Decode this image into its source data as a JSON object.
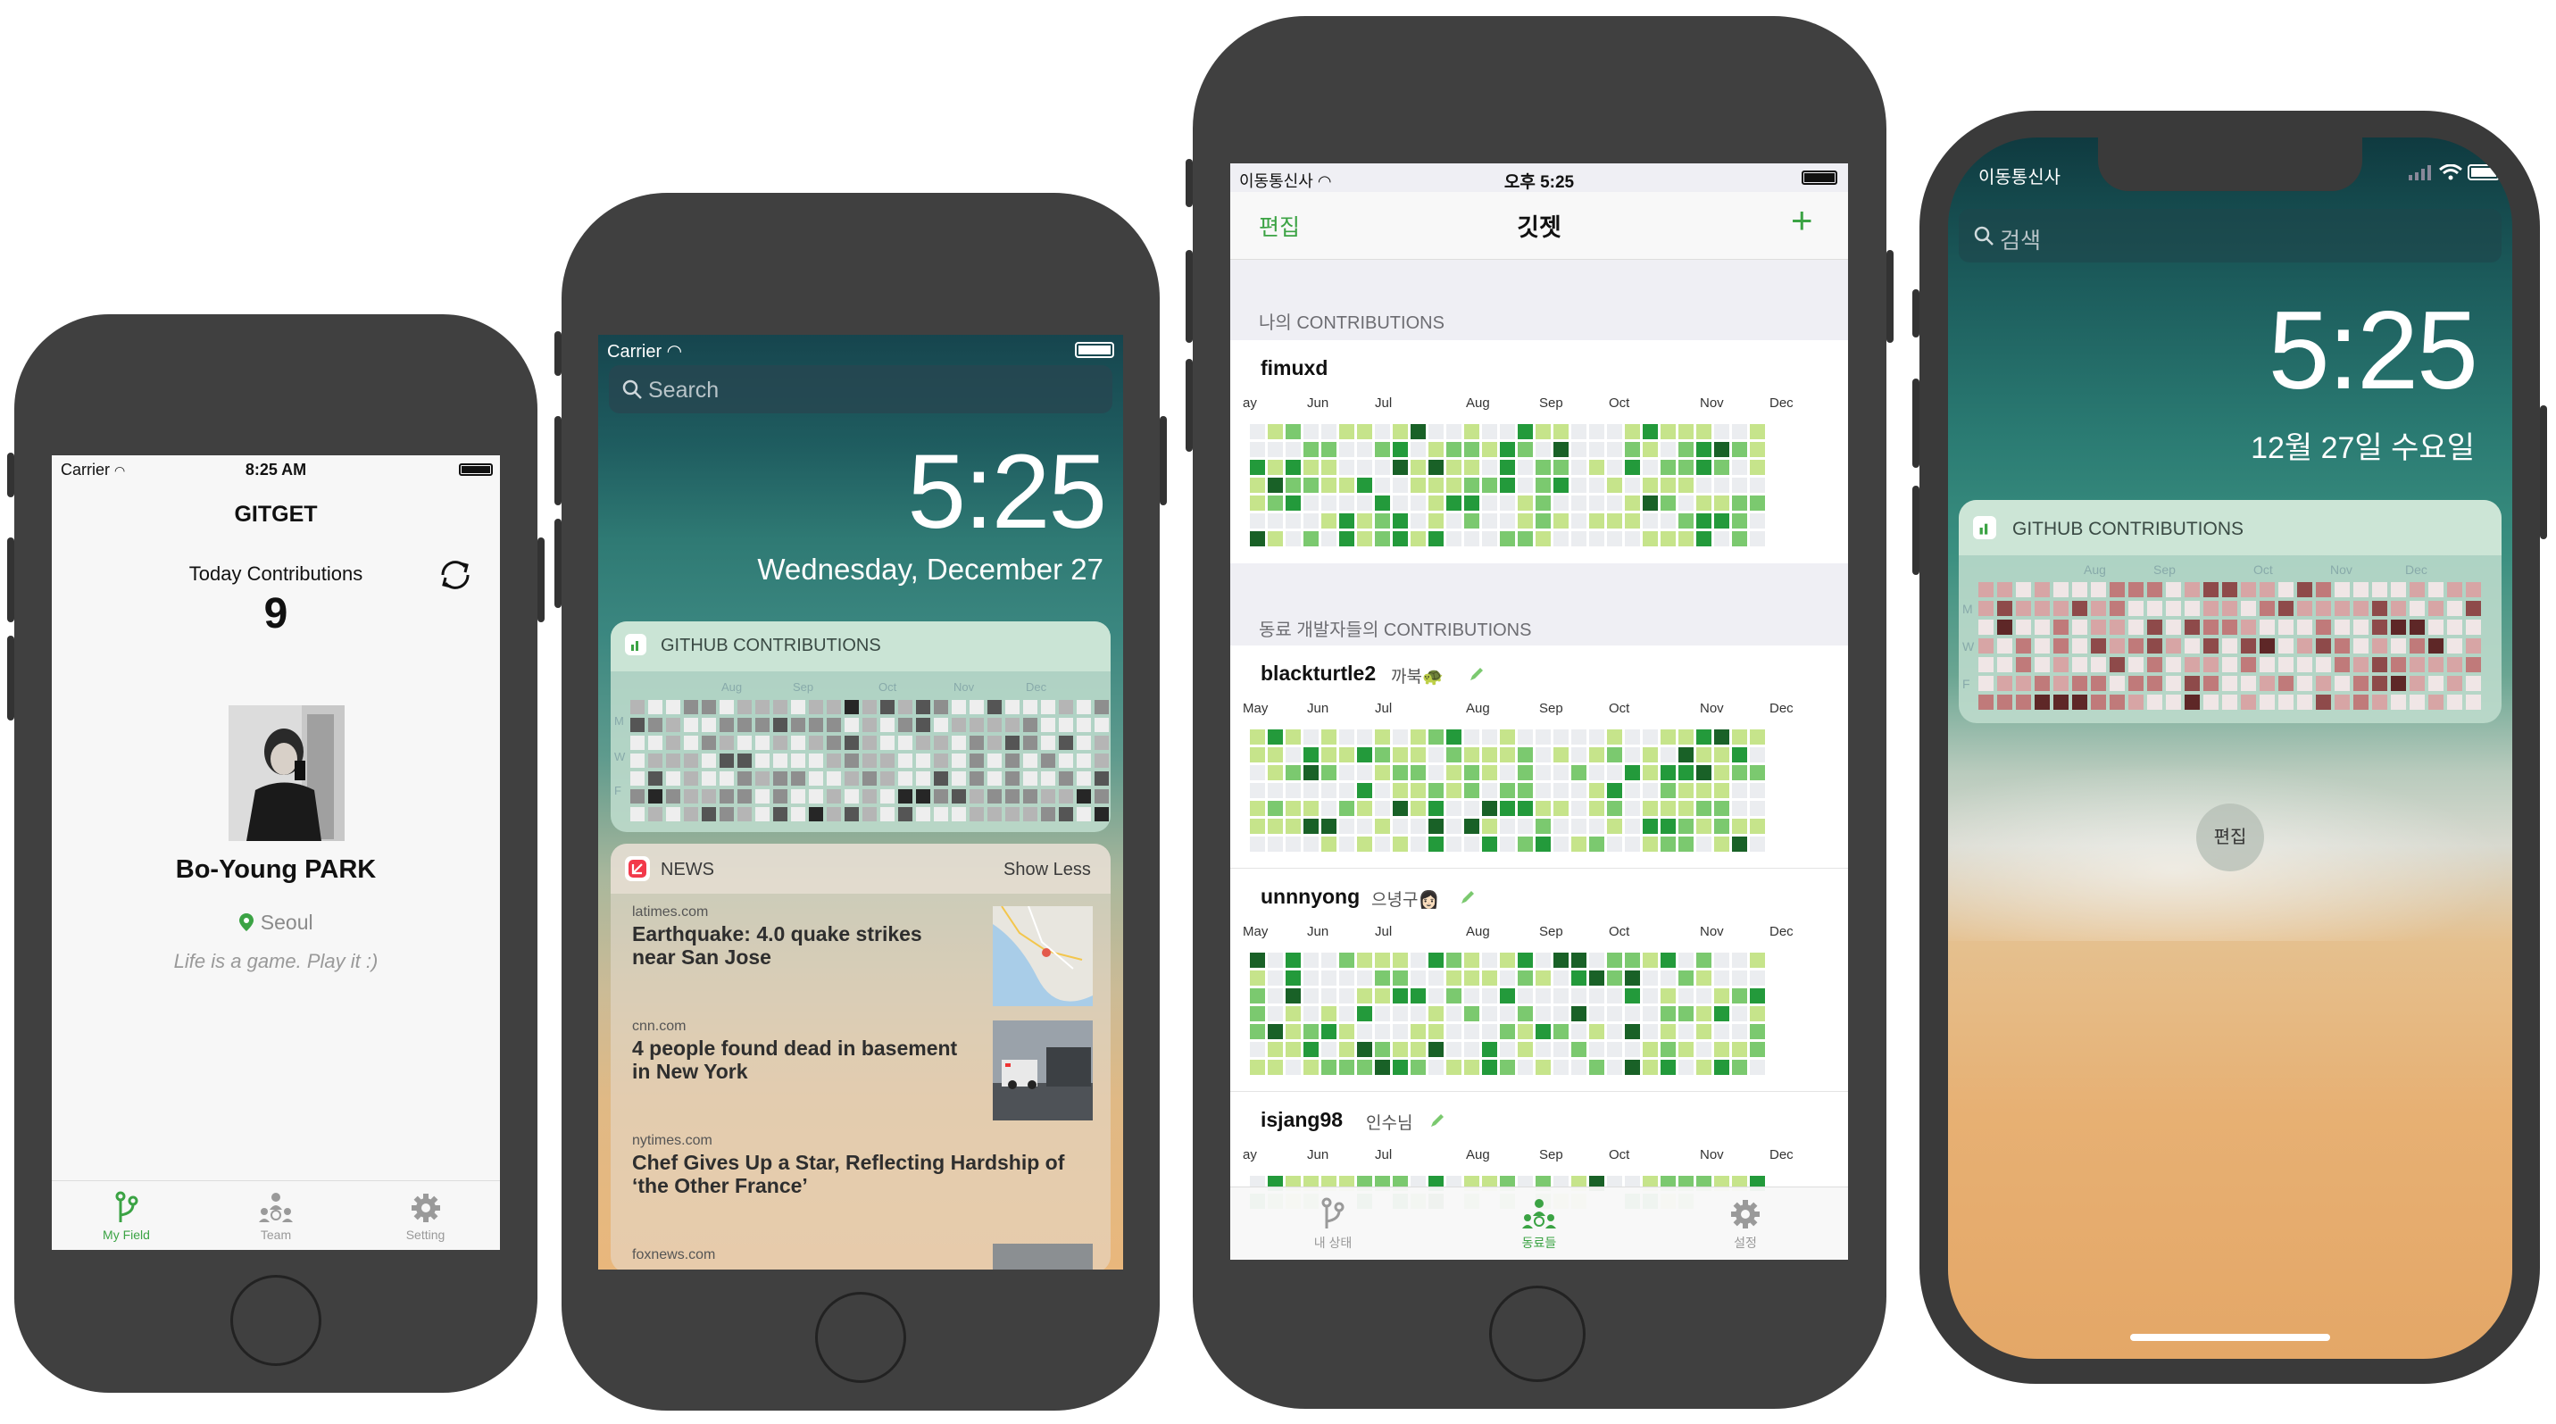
{
  "colors": {
    "accent_green": "#3ba344",
    "phone_body": "#404040",
    "contrib_levels": [
      "#ebedf0",
      "#c6e48b",
      "#7bc96f",
      "#239a3b",
      "#196127"
    ],
    "gray_levels": [
      "#eeeeee",
      "#b5b5b5",
      "#8e8e8e",
      "#555555",
      "#262626"
    ],
    "red_levels": [
      "#f0e6e6",
      "#d7a5a5",
      "#c07a7a",
      "#8e4a4a",
      "#5e2727"
    ]
  },
  "phone1": {
    "status": {
      "carrier": "Carrier",
      "time": "8:25 AM"
    },
    "nav_title": "GITGET",
    "today_label": "Today Contributions",
    "today_count": "9",
    "icons": {
      "refresh": "refresh-icon",
      "location": "location-pin-icon"
    },
    "profile": {
      "name": "Bo-Young PARK",
      "location": "Seoul",
      "bio": "Life is a game. Play it :)"
    },
    "tabs": [
      {
        "label": "My Field",
        "icon": "branch-icon",
        "active": true
      },
      {
        "label": "Team",
        "icon": "team-icon",
        "active": false
      },
      {
        "label": "Setting",
        "icon": "gear-icon",
        "active": false
      }
    ]
  },
  "phone2": {
    "status": {
      "carrier": "Carrier"
    },
    "search_placeholder": "Search",
    "time": "5:25",
    "date": "Wednesday, December 27",
    "widget": {
      "title": "GITHUB CONTRIBUTIONS",
      "months": [
        "Aug",
        "Sep",
        "Oct",
        "Nov",
        "Dec"
      ],
      "days": [
        "M",
        "W",
        "F"
      ]
    },
    "news": {
      "title": "NEWS",
      "toggle": "Show Less",
      "items": [
        {
          "source": "latimes.com",
          "headline": "Earthquake: 4.0 quake strikes near San Jose"
        },
        {
          "source": "cnn.com",
          "headline": "4 people found dead in basement in New York"
        },
        {
          "source": "nytimes.com",
          "headline": "Chef Gives Up a Star, Reflecting Hardship of ‘the Other France’"
        },
        {
          "source": "foxnews.com",
          "headline": ""
        }
      ]
    }
  },
  "phone3": {
    "status": {
      "carrier": "이동통신사",
      "time": "오후 5:25"
    },
    "nav": {
      "edit": "편집",
      "title": "깃젯",
      "add": "+"
    },
    "my_section": "나의 CONTRIBUTIONS",
    "team_section": "동료 개발자들의 CONTRIBUTIONS",
    "me": {
      "username": "fimuxd",
      "months": [
        "ay",
        "Jun",
        "Jul",
        "Aug",
        "Sep",
        "Oct",
        "Nov",
        "Dec"
      ]
    },
    "teammates": [
      {
        "username": "blackturtle2",
        "nickname": "까북🐢",
        "months": [
          "May",
          "Jun",
          "Jul",
          "Aug",
          "Sep",
          "Oct",
          "Nov",
          "Dec"
        ]
      },
      {
        "username": "unnnyong",
        "nickname": "으녕구👩🏻",
        "months": [
          "May",
          "Jun",
          "Jul",
          "Aug",
          "Sep",
          "Oct",
          "Nov",
          "Dec"
        ]
      },
      {
        "username": "isjang98",
        "nickname": "인수님",
        "months": [
          "ay",
          "Jun",
          "Jul",
          "Aug",
          "Sep",
          "Oct",
          "Nov",
          "Dec"
        ]
      }
    ],
    "tabs": [
      {
        "label": "내 상태",
        "icon": "branch-icon",
        "active": false
      },
      {
        "label": "동료들",
        "icon": "team-icon",
        "active": true
      },
      {
        "label": "설정",
        "icon": "gear-icon",
        "active": false
      }
    ]
  },
  "phone4": {
    "status": {
      "carrier": "이동통신사"
    },
    "search_placeholder": "검색",
    "time": "5:25",
    "date": "12월 27일 수요일",
    "widget": {
      "title": "GITHUB CONTRIBUTIONS",
      "months": [
        "Aug",
        "Sep",
        "Oct",
        "Nov",
        "Dec"
      ],
      "days": [
        "M",
        "W",
        "F"
      ]
    },
    "edit_button": "편집"
  }
}
